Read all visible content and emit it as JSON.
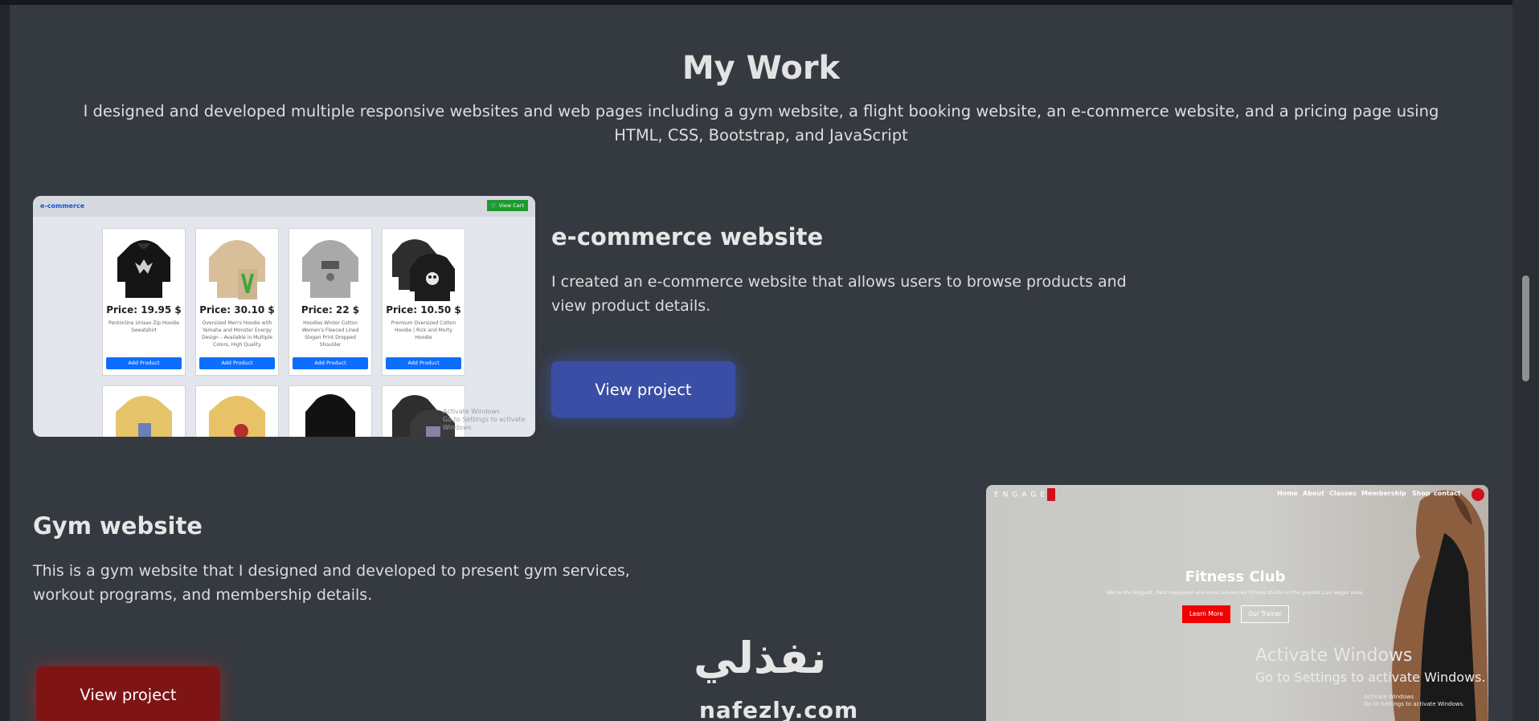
{
  "section": {
    "title": "My Work",
    "intro": "I designed and developed multiple responsive websites and web pages including a gym website, a flight booking website, an e-commerce website, and a pricing page using HTML, CSS, Bootstrap, and JavaScript"
  },
  "projects": [
    {
      "title": "e-commerce website",
      "description": "I created an e-commerce website that allows users to browse products and view product details.",
      "button": "View project",
      "accent": "#3a4ea6"
    },
    {
      "title": "Gym website",
      "description": "This is a gym website that I designed and developed to present gym services, workout programs, and membership details.",
      "button": "View project",
      "accent": "#7e1414"
    }
  ],
  "ecommerce_preview": {
    "logo": "e-commerce",
    "cart": "🛒 View Cart",
    "products": [
      {
        "price": "Price: 19.95 $",
        "desc": "Pentonline Unisex Zip Hoodie Sweatshirt",
        "button": "Add Product"
      },
      {
        "price": "Price: 30.10 $",
        "desc": "Oversized Men's Hoodie with Yamaha and Monster Energy Design – Available in Multiple Colors, High Quality",
        "button": "Add Product"
      },
      {
        "price": "Price: 22 $",
        "desc": "Hoodies Winter Cotton Women's Fleeced Lined Slogan Print Dropped Shoulder",
        "button": "Add Product"
      },
      {
        "price": "Price: 10.50 $",
        "desc": "Premium Oversized Cotton Hoodie | Rick and Morty Hoodie",
        "button": "Add Product"
      }
    ],
    "watermark_line1": "Activate Windows",
    "watermark_line2": "Go to Settings to activate Windows."
  },
  "gym_preview": {
    "logo": "ENGAGE",
    "nav": [
      "Home",
      "About",
      "Classes",
      "Membership",
      "Shop",
      "contact"
    ],
    "heading": "Fitness Club",
    "subheading": "We're the biggest, best equipped and most advanced fitness studio in the greater Las Vegas area.",
    "learn_more": "Learn More",
    "our_trainer": "Our Trainer",
    "activate_title": "Activate Windows",
    "activate_sub": "Go to Settings to activate Windows.",
    "activate_small1": "Activate Windows",
    "activate_small2": "Go to Settings to activate Windows."
  },
  "watermark": {
    "arabic": "نفذلي",
    "latin": "nafezly.com"
  }
}
